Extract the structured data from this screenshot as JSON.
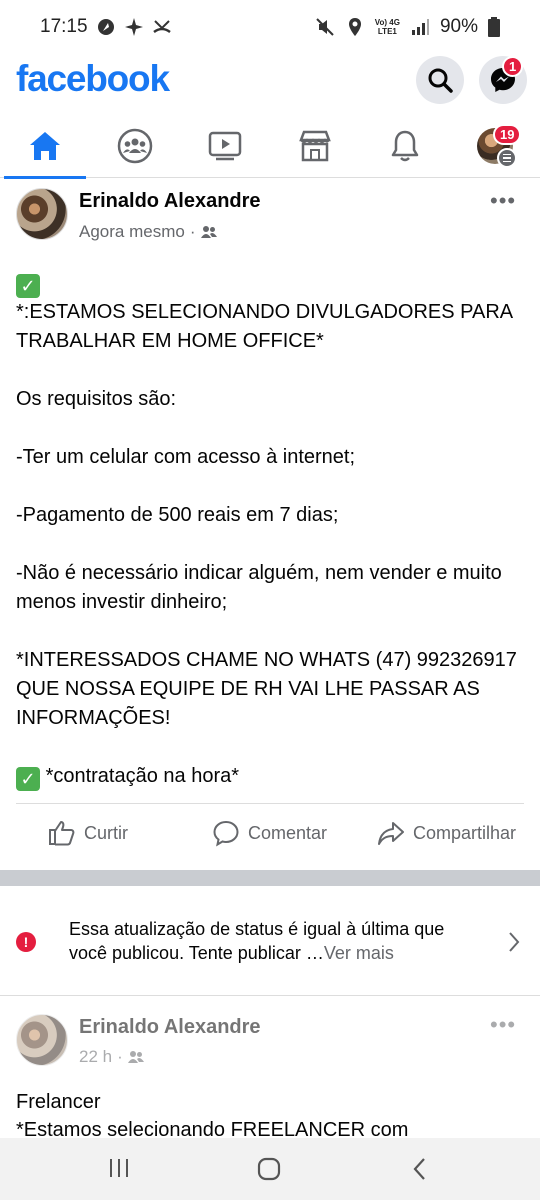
{
  "status_bar": {
    "time": "17:15",
    "network": "Vo) 4G",
    "network_sub": "LTE1",
    "battery": "90%"
  },
  "header": {
    "logo": "facebook",
    "messenger_badge": "1"
  },
  "nav": {
    "tabs": [
      "Home",
      "Groups",
      "Watch",
      "Marketplace",
      "Notifications",
      "Menu"
    ],
    "menu_badge": "19"
  },
  "post": {
    "author": "Erinaldo Alexandre",
    "time": "Agora mesmo",
    "audience_icon": "friends-icon",
    "more": "•••",
    "check_emoji": "✓",
    "line1": "*:ESTAMOS SELECIONANDO  DIVULGADORES PARA TRABALHAR EM HOME OFFICE*",
    "line2": "Os requisitos são:",
    "line3": "-Ter um celular com acesso à  internet;",
    "line4": "-Pagamento de 500 reais em 7 dias;",
    "line5": "-Não é  necessário indicar alguém, nem vender e muito menos investir dinheiro;",
    "line6": "*INTERESSADOS CHAME NO WHATS (47) 992326917 QUE NOSSA EQUIPE DE RH VAI LHE PASSAR AS INFORMAÇÕES!",
    "line7": "*contratação na hora*",
    "actions": {
      "like": "Curtir",
      "comment": "Comentar",
      "share": "Compartilhar"
    }
  },
  "notice": {
    "text": "Essa atualização de status é igual à última que você publicou. Tente publicar …",
    "more": "Ver mais"
  },
  "post2": {
    "author": "Erinaldo Alexandre",
    "time": "22 h",
    "more": "•••",
    "text1": "Frelancer",
    "text2": "*Estamos selecionando FREELANCER com"
  },
  "colors": {
    "brand": "#1877f2",
    "badge": "#e41e3f",
    "secondary_text": "#65676b"
  }
}
